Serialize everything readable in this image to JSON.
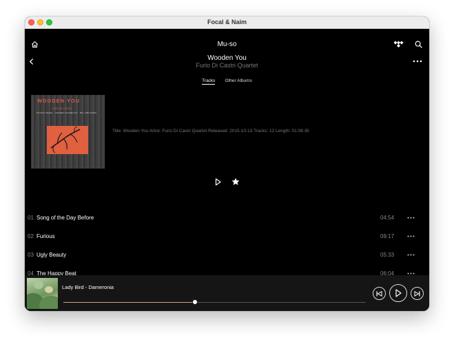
{
  "window": {
    "title": "Focal & Naim"
  },
  "header": {
    "device_name": "Mu-so",
    "album_title": "Wooden You",
    "album_artist": "Furio Di Castri Quartet"
  },
  "tabs": [
    {
      "label": "Tracks",
      "active": true
    },
    {
      "label": "Other Albums",
      "active": false
    }
  ],
  "cover": {
    "title": "WOODEN YOU",
    "subtitle": "FURIO DI CASTRI",
    "credits": "MAURO NEGRI · ANDREA DULBECCO · BILL BRUFORD"
  },
  "album_info": "Title: Wooden You Artist: Furio Di Castri Quartet Released: 2015-10-13 Tracks: 12 Length: 01:08:35",
  "tracks": [
    {
      "num": "01",
      "name": "Song of the Day Before",
      "duration": "04:54"
    },
    {
      "num": "02",
      "name": "Furious",
      "duration": "09:17"
    },
    {
      "num": "03",
      "name": "Ugly Beauty",
      "duration": "05:33"
    },
    {
      "num": "04",
      "name": "The Happy Beat",
      "duration": "06:04"
    }
  ],
  "now_playing": {
    "title": "Lady Bird - Dameronia",
    "progress": 0.436
  },
  "icons": {
    "home": "home-icon",
    "tidal": "tidal-icon",
    "search": "search-icon",
    "back": "back-icon",
    "more": "more-icon",
    "play": "play-icon",
    "favorite": "star-icon",
    "previous": "previous-icon",
    "next": "next-icon"
  },
  "colors": {
    "background": "#000000",
    "player_bar": "#151515",
    "progress_accent": "#c8a58a",
    "cover_accent": "#e0603f"
  }
}
